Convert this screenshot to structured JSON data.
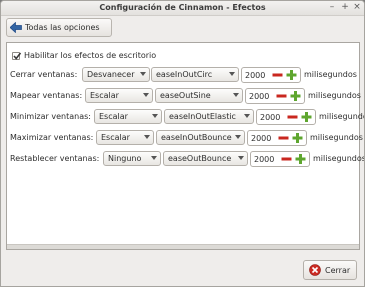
{
  "window": {
    "title": "Configuración de Cinnamon - Efectos",
    "controls": {
      "minimize": "–",
      "maximize": "+",
      "close": "×"
    }
  },
  "toolbar": {
    "back_label": "Todas las opciones",
    "back_icon": "arrow-left-icon"
  },
  "enable_effects": {
    "label": "Habilitar los efectos de escritorio",
    "checked": true
  },
  "rows": [
    {
      "label": "Cerrar ventanas:",
      "effect": "Desvanecer",
      "easing": "easeInOutCirc",
      "duration": "2000",
      "unit": "milisegundos"
    },
    {
      "label": "Mapear ventanas:",
      "effect": "Escalar",
      "easing": "easeOutSine",
      "duration": "2000",
      "unit": "milisegundos"
    },
    {
      "label": "Minimizar ventanas:",
      "effect": "Escalar",
      "easing": "easeInOutElastic",
      "duration": "2000",
      "unit": "milisegundos"
    },
    {
      "label": "Maximizar ventanas:",
      "effect": "Escalar",
      "easing": "easeInOutBounce",
      "duration": "2000",
      "unit": "milisegundos"
    },
    {
      "label": "Restablecer ventanas:",
      "effect": "Ninguno",
      "easing": "easeOutBounce",
      "duration": "2000",
      "unit": "milisegundos"
    }
  ],
  "footer": {
    "cancel_label": "Cerrar",
    "cancel_icon": "close-red-icon"
  },
  "colors": {
    "minus": "#c9271f",
    "plus": "#5ea62e",
    "arrow": "#3465a4"
  }
}
